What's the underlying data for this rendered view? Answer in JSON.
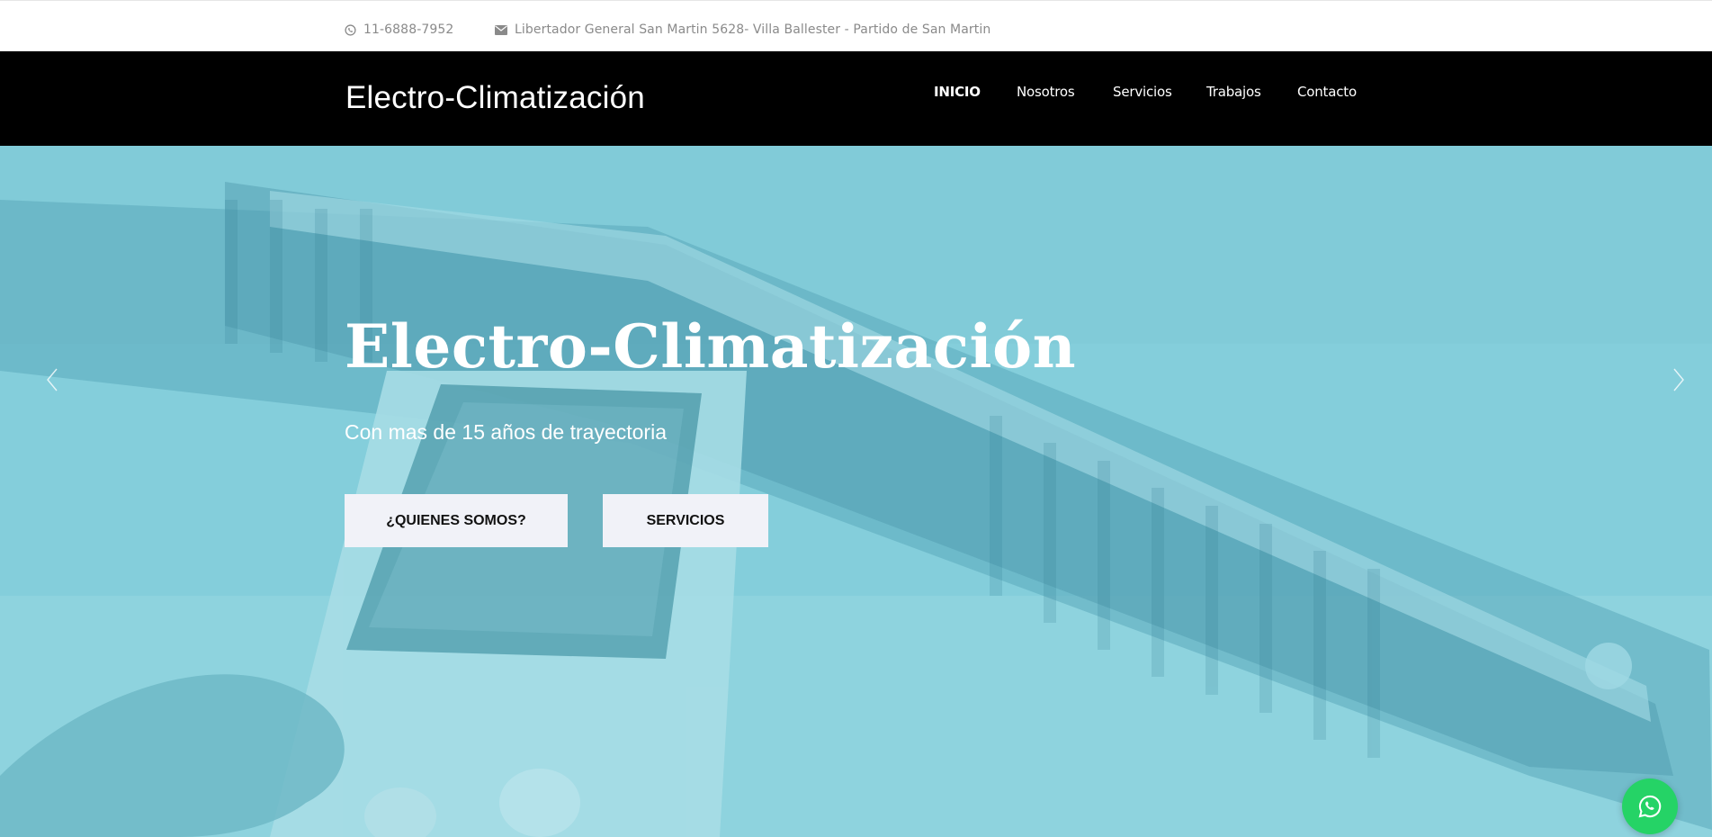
{
  "topbar": {
    "phone": "11-6888-7952",
    "phone_icon": "whatsapp-icon",
    "address": "Libertador General San Martin 5628- Villa Ballester - Partido de San Martin",
    "address_icon": "envelope-icon"
  },
  "navbar": {
    "brand": "Electro-Climatización",
    "links": [
      {
        "label": "INICIO",
        "active": true
      },
      {
        "label": "Nosotros",
        "active": false
      },
      {
        "label": "Servicios",
        "active": false
      },
      {
        "label": "Trabajos",
        "active": false
      },
      {
        "label": "Contacto",
        "active": false
      }
    ]
  },
  "hero": {
    "title": "Electro-Climatización",
    "subtitle": "Con mas de 15 años de trayectoria",
    "buttons": {
      "about": "¿QUIENES SOMOS?",
      "services": "SERVICIOS"
    },
    "prev_icon": "chevron-left-icon",
    "next_icon": "chevron-right-icon",
    "overlay_color": "#7ccbd8"
  },
  "whatsapp": {
    "icon": "whatsapp-icon",
    "color": "#25d366"
  },
  "colors": {
    "navbar_bg": "#000000",
    "topbar_text": "#8a8a8a",
    "button_bg": "#f1f2f8"
  }
}
